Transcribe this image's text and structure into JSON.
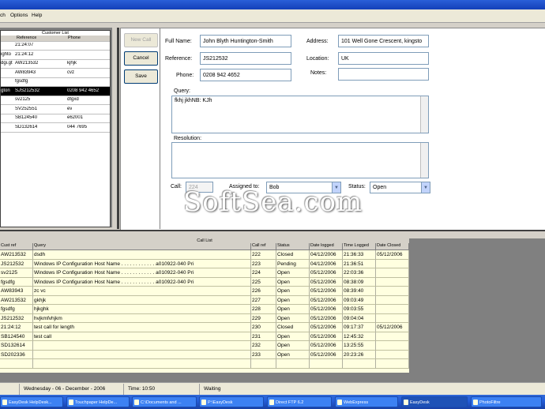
{
  "menu": {
    "items": [
      "ch",
      "Options",
      "Help"
    ]
  },
  "customers": {
    "title": "Customer List",
    "columns": [
      "Reference",
      "Phone"
    ],
    "rows": [
      {
        "name": "",
        "ref": "21:24:07",
        "phone": "",
        "selected": false
      },
      {
        "name": "ighto",
        "ref": "21:24:12",
        "phone": "",
        "selected": false
      },
      {
        "name": "dgi.gt",
        "ref": "AW213532",
        "phone": "kjhjk",
        "selected": false
      },
      {
        "name": "",
        "ref": "AW83943",
        "phone": "cvz",
        "selected": false
      },
      {
        "name": "",
        "ref": "fgsdfg",
        "phone": "",
        "selected": false
      },
      {
        "name": "gton",
        "ref": "SJS212532",
        "phone": "0208 942 4652",
        "selected": true
      },
      {
        "name": "",
        "ref": "sv2125",
        "phone": "dfgxd",
        "selected": false
      },
      {
        "name": "",
        "ref": "SV252551",
        "phone": "ev",
        "selected": false
      },
      {
        "name": "",
        "ref": "SB124540",
        "phone": "e62001",
        "selected": false
      },
      {
        "name": "",
        "ref": "SD132614",
        "phone": "044 7695",
        "selected": false
      }
    ]
  },
  "form": {
    "new_call_label": "New Call",
    "cancel_label": "Cancel",
    "save_label": "Save",
    "fullname_label": "Full Name:",
    "fullname_value": "John Blyth Huntington-Smith",
    "reference_label": "Reference:",
    "reference_value": "JS212532",
    "phone_label": "Phone:",
    "phone_value": "0208 942 4652",
    "address_label": "Address:",
    "address_value": "101 Well Gone Crescent, kingsto",
    "location_label": "Location:",
    "location_value": "UK",
    "notes_label": "Notes:",
    "notes_value": "",
    "query_label": "Query:",
    "query_value": "fkhj jkhNB: KJh",
    "resolution_label": "Resolution:",
    "resolution_value": "",
    "call_label": "Call:",
    "call_value": "224",
    "assigned_label": "Assigned to:",
    "assigned_value": "Bob",
    "status_label": "Status:",
    "status_value": "Open"
  },
  "calls": {
    "title": "Call List",
    "columns": [
      "Cust ref",
      "Query",
      "Call ref",
      "Status",
      "Date logged",
      "Time Logged",
      "Date Closed"
    ],
    "rows": [
      [
        "AW213532",
        "dsdh",
        "222",
        "Closed",
        "04/12/2006",
        "21:36:33",
        "05/12/2006"
      ],
      [
        "JS212532",
        "Windows IP Configuration        Host Name . . . . . . . . . . . . a010922-040        Pri",
        "223",
        "Pending",
        "04/12/2006",
        "21:36:51",
        ""
      ],
      [
        "sv2125",
        "Windows IP Configuration        Host Name . . . . . . . . . . . . a010922-040        Pri",
        "224",
        "Open",
        "05/12/2006",
        "22:03:36",
        ""
      ],
      [
        "fgsdfg",
        "Windows IP Configuration        Host Name . . . . . . . . . . . . a010922-040        Pri",
        "225",
        "Open",
        "05/12/2006",
        "08:38:09",
        ""
      ],
      [
        "AW83943",
        "zc vc",
        "226",
        "Open",
        "05/12/2006",
        "08:39:40",
        ""
      ],
      [
        "AW213532",
        "gkhjk",
        "227",
        "Open",
        "05/12/2006",
        "09:03:49",
        ""
      ],
      [
        "fgsdfg",
        "hjkghk",
        "228",
        "Open",
        "05/12/2006",
        "09:03:55",
        ""
      ],
      [
        "JS212532",
        "hvjkmfvhjkm",
        "229",
        "Open",
        "05/12/2006",
        "09:04:04",
        ""
      ],
      [
        "21:24:12",
        "test call for length",
        "230",
        "Closed",
        "05/12/2006",
        "09:17:37",
        "05/12/2006"
      ],
      [
        "SB124540",
        "test call",
        "231",
        "Open",
        "05/12/2006",
        "12:45:32",
        ""
      ],
      [
        "SD132614",
        "",
        "232",
        "Open",
        "05/12/2006",
        "13:25:55",
        ""
      ],
      [
        "SD202336",
        "",
        "233",
        "Open",
        "05/12/2006",
        "20:23:26",
        ""
      ],
      [
        "",
        "",
        "",
        "",
        "",
        "",
        ""
      ]
    ]
  },
  "status": {
    "date": "Wednesday - 06 - December - 2006",
    "time": "Time: 10:50",
    "state": "Waiting"
  },
  "taskbar": {
    "items": [
      {
        "label": "EasyDesk HelpDesk...",
        "active": false
      },
      {
        "label": "Touchpaper HelpDe...",
        "active": false
      },
      {
        "label": "C:\\Documents and ...",
        "active": false
      },
      {
        "label": "P:\\EasyDesk",
        "active": false
      },
      {
        "label": "Direct FTP 6.2",
        "active": false
      },
      {
        "label": "WebExpress",
        "active": false
      },
      {
        "label": "EasyDesk",
        "active": true
      },
      {
        "label": "PhotoFiltre",
        "active": false
      }
    ]
  },
  "watermark": "SoftSea.com"
}
